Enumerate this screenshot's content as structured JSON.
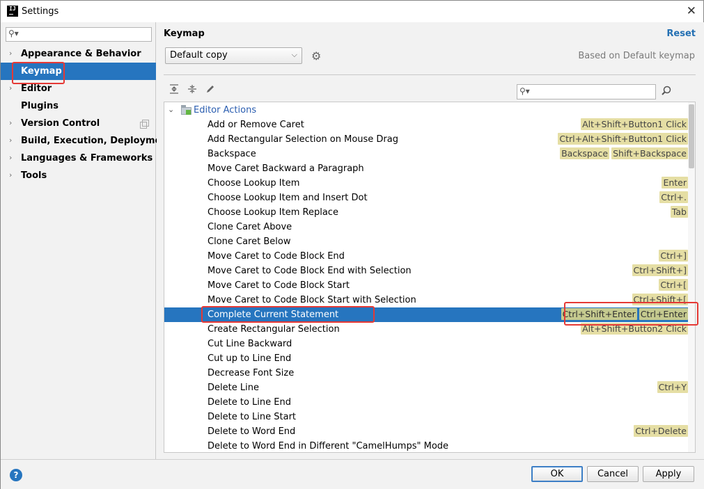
{
  "window": {
    "title": "Settings",
    "app_icon_text": "IJ"
  },
  "sidebar": {
    "search_placeholder": "",
    "items": [
      {
        "label": "Appearance & Behavior",
        "expandable": true
      },
      {
        "label": "Keymap",
        "expandable": false,
        "selected": true
      },
      {
        "label": "Editor",
        "expandable": true
      },
      {
        "label": "Plugins",
        "expandable": false
      },
      {
        "label": "Version Control",
        "expandable": true,
        "has_copy_icon": true
      },
      {
        "label": "Build, Execution, Deployment",
        "expandable": true
      },
      {
        "label": "Languages & Frameworks",
        "expandable": true
      },
      {
        "label": "Tools",
        "expandable": true
      }
    ]
  },
  "panel": {
    "title": "Keymap",
    "reset_label": "Reset",
    "keymap_selected": "Default copy",
    "based_on": "Based on Default keymap",
    "filter_placeholder": ""
  },
  "tree": {
    "group_label": "Editor Actions",
    "rows": [
      {
        "name": "Add or Remove Caret",
        "shortcuts": [
          "Alt+Shift+Button1 Click"
        ]
      },
      {
        "name": "Add Rectangular Selection on Mouse Drag",
        "shortcuts": [
          "Ctrl+Alt+Shift+Button1 Click"
        ]
      },
      {
        "name": "Backspace",
        "shortcuts": [
          "Backspace",
          "Shift+Backspace"
        ]
      },
      {
        "name": "Move Caret Backward a Paragraph",
        "shortcuts": []
      },
      {
        "name": "Choose Lookup Item",
        "shortcuts": [
          "Enter"
        ]
      },
      {
        "name": "Choose Lookup Item and Insert Dot",
        "shortcuts": [
          "Ctrl+."
        ]
      },
      {
        "name": "Choose Lookup Item Replace",
        "shortcuts": [
          "Tab"
        ]
      },
      {
        "name": "Clone Caret Above",
        "shortcuts": []
      },
      {
        "name": "Clone Caret Below",
        "shortcuts": []
      },
      {
        "name": "Move Caret to Code Block End",
        "shortcuts": [
          "Ctrl+]"
        ]
      },
      {
        "name": "Move Caret to Code Block End with Selection",
        "shortcuts": [
          "Ctrl+Shift+]"
        ]
      },
      {
        "name": "Move Caret to Code Block Start",
        "shortcuts": [
          "Ctrl+["
        ]
      },
      {
        "name": "Move Caret to Code Block Start with Selection",
        "shortcuts": [
          "Ctrl+Shift+["
        ]
      },
      {
        "name": "Complete Current Statement",
        "shortcuts": [
          "Ctrl+Shift+Enter",
          "Ctrl+Enter"
        ],
        "selected": true
      },
      {
        "name": "Create Rectangular Selection",
        "shortcuts": [
          "Alt+Shift+Button2 Click"
        ]
      },
      {
        "name": "Cut Line Backward",
        "shortcuts": []
      },
      {
        "name": "Cut up to Line End",
        "shortcuts": []
      },
      {
        "name": "Decrease Font Size",
        "shortcuts": []
      },
      {
        "name": "Delete Line",
        "shortcuts": [
          "Ctrl+Y"
        ]
      },
      {
        "name": "Delete to Line End",
        "shortcuts": []
      },
      {
        "name": "Delete to Line Start",
        "shortcuts": []
      },
      {
        "name": "Delete to Word End",
        "shortcuts": [
          "Ctrl+Delete"
        ]
      },
      {
        "name": "Delete to Word End in Different \"CamelHumps\" Mode",
        "shortcuts": []
      }
    ]
  },
  "buttons": {
    "ok": "OK",
    "cancel": "Cancel",
    "apply": "Apply",
    "help": "?"
  },
  "colors": {
    "selection": "#2675bf",
    "shortcut_bg": "#e5dea4",
    "link": "#2470b3",
    "annotation": "#e53935"
  }
}
